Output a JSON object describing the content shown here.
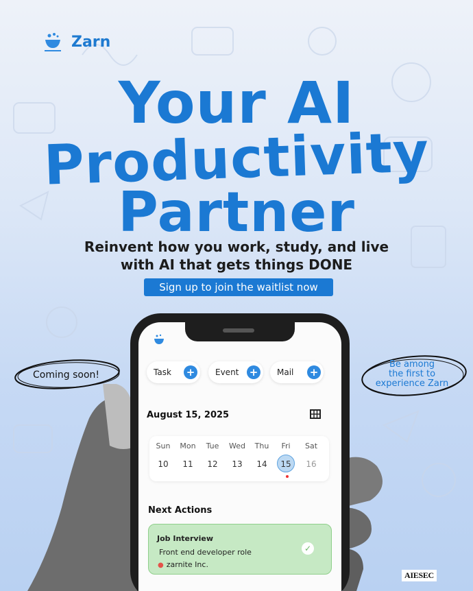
{
  "brand": {
    "name": "Zarn",
    "accent_color": "#1b79d3",
    "logo_icon": "cup-icon"
  },
  "headline": {
    "line1": "Your AI",
    "line2": "Productivity",
    "line3": "Partner"
  },
  "subheadline": {
    "line1": "Reinvent how you work, study, and live",
    "line2": "with AI that gets things DONE"
  },
  "cta_label": "Sign up to join the waitlist now",
  "callouts": {
    "left": "Coming soon!",
    "right_line1": "Be among",
    "right_line2": "the first to",
    "right_line3": "experience Zarn"
  },
  "app": {
    "quick_actions": [
      {
        "label": "Task",
        "icon": "plus-icon"
      },
      {
        "label": "Event",
        "icon": "plus-icon"
      },
      {
        "label": "Mail",
        "icon": "plus-icon"
      }
    ],
    "date_title": "August 15, 2025",
    "calendar_icon": "grid-icon",
    "week": [
      {
        "day": "Sun",
        "date": "10"
      },
      {
        "day": "Mon",
        "date": "11"
      },
      {
        "day": "Tue",
        "date": "12"
      },
      {
        "day": "Wed",
        "date": "13"
      },
      {
        "day": "Thu",
        "date": "14"
      },
      {
        "day": "Fri",
        "date": "15"
      },
      {
        "day": "Sat",
        "date": "16"
      }
    ],
    "selected_date": "15",
    "section_title": "Next Actions",
    "next_action": {
      "title": "Job Interview",
      "role": "Front end  developer role",
      "company": "zarnite Inc.",
      "location_icon": "pin-icon",
      "status_icon": "check-icon",
      "color": "#c6e9c4"
    }
  },
  "footer_brand": "AIESEC"
}
